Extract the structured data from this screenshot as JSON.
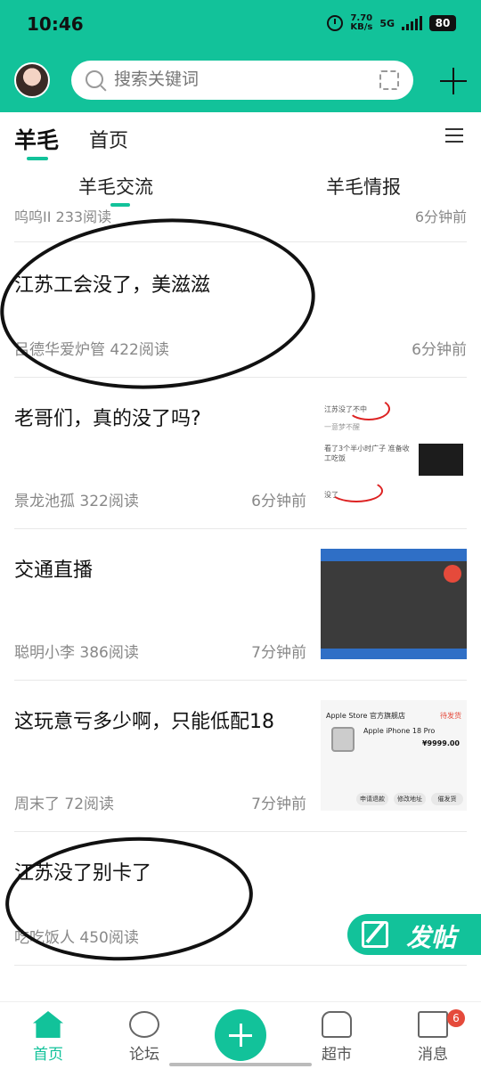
{
  "status_bar": {
    "time": "10:46",
    "net_speed": "7.70",
    "net_unit": "KB/s",
    "network": "5G",
    "battery": "80"
  },
  "search": {
    "placeholder": "搜索关键词"
  },
  "tabs": {
    "main": "羊毛",
    "home": "首页"
  },
  "subtabs": {
    "exchange": "羊毛交流",
    "intel": "羊毛情报"
  },
  "partial_post": {
    "meta": "呜呜II 233阅读",
    "time": "6分钟前"
  },
  "posts": [
    {
      "title": "江苏工会没了，美滋滋",
      "meta": "吕德华爱炉管 422阅读",
      "time": "6分钟前"
    },
    {
      "title": "老哥们，真的没了吗?",
      "meta": "景龙池孤 322阅读",
      "time": "6分钟前"
    },
    {
      "title": "交通直播",
      "meta": "聪明小李 386阅读",
      "time": "7分钟前"
    },
    {
      "title": "这玩意亏多少啊，只能低配18",
      "meta": "周末了 72阅读",
      "time": "7分钟前"
    },
    {
      "title": "江苏没了别卡了",
      "meta": "吃吃饭人 450阅读",
      "time": ""
    }
  ],
  "thumb1": {
    "line1": "江苏没了不中",
    "line2": "一意梦不醒",
    "line3": "看了3个半小时广子 准备收工吃饭",
    "line4": "没了"
  },
  "thumb3": {
    "store": "Apple Store 官方旗舰店",
    "status": "待发货",
    "product": "Apple iPhone 18 Pro",
    "price": "¥9999.00",
    "btn1": "申请退款",
    "btn2": "修改地址",
    "btn3": "催发货"
  },
  "fab": {
    "label": "发帖"
  },
  "nav": {
    "home": "首页",
    "forum": "论坛",
    "market": "超市",
    "messages": "消息",
    "badge": "6"
  },
  "colors": {
    "accent": "#12c29a"
  }
}
